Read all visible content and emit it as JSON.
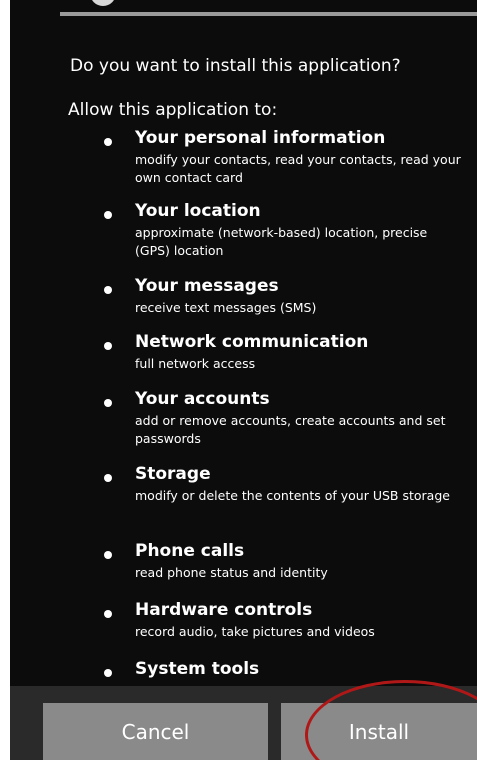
{
  "dialog": {
    "question": "Do you want to install this application?",
    "allow_label": "Allow this application to:"
  },
  "permissions": [
    {
      "title": "Your personal information",
      "desc": "modify your contacts, read your contacts, read your own contact card"
    },
    {
      "title": "Your location",
      "desc": "approximate (network-based) location, precise (GPS) location"
    },
    {
      "title": "Your messages",
      "desc": "receive text messages (SMS)"
    },
    {
      "title": "Network communication",
      "desc": "full network access"
    },
    {
      "title": "Your accounts",
      "desc": "add or remove accounts, create accounts and set passwords"
    },
    {
      "title": "Storage",
      "desc": "modify or delete the contents of your USB storage"
    },
    {
      "title": "Phone calls",
      "desc": "read phone status and identity"
    },
    {
      "title": "Hardware controls",
      "desc": "record audio, take pictures and videos"
    },
    {
      "title": "System tools",
      "desc": ""
    }
  ],
  "buttons": {
    "cancel_label": "Cancel",
    "install_label": "Install"
  },
  "colors": {
    "background": "#0c0c0c",
    "button": "#8a8a8a",
    "annotation": "#b01818"
  }
}
